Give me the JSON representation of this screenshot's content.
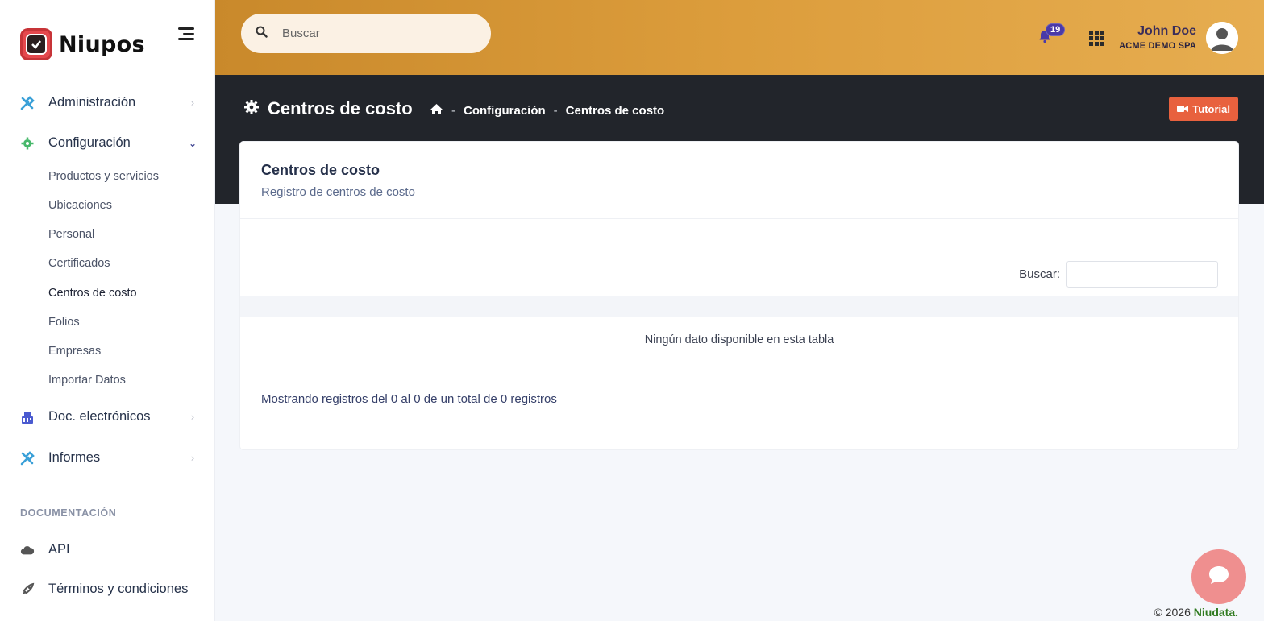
{
  "brand": {
    "name": "Niupos"
  },
  "header": {
    "search_placeholder": "Buscar",
    "notifications_count": "19",
    "user_name": "John Doe",
    "user_company": "ACME DEMO SPA"
  },
  "sidebar": {
    "items": [
      {
        "label": "Administración",
        "icon": "tools-icon",
        "chevron": "›"
      },
      {
        "label": "Configuración",
        "icon": "gear-icon",
        "chevron": "⌄"
      },
      {
        "label": "Doc. electrónicos",
        "icon": "register-icon",
        "chevron": "›"
      },
      {
        "label": "Informes",
        "icon": "tools-icon",
        "chevron": "›"
      }
    ],
    "subitems": [
      "Productos y servicios",
      "Ubicaciones",
      "Personal",
      "Certificados",
      "Centros de costo",
      "Folios",
      "Empresas",
      "Importar Datos"
    ],
    "active_subitem": "Centros de costo",
    "section_title": "DOCUMENTACIÓN",
    "docs": [
      {
        "label": "API",
        "icon": "cloud-icon"
      },
      {
        "label": "Términos y condiciones",
        "icon": "rocket-icon"
      }
    ]
  },
  "page": {
    "title": "Centros de costo",
    "breadcrumb": [
      "Configuración",
      "Centros de costo"
    ],
    "breadcrumb_sep": "-",
    "tutorial_label": "Tutorial"
  },
  "card": {
    "title": "Centros de costo",
    "subtitle": "Registro de centros de costo",
    "search_label": "Buscar:",
    "empty_message": "Ningún dato disponible en esta tabla",
    "info": "Mostrando registros del 0 al 0 de un total de 0 registros"
  },
  "footer": {
    "copyright": "© 2026",
    "brand": "Niudata."
  },
  "colors": {
    "accent": "#dc9d3c",
    "band": "#22252b",
    "tutorial": "#e8613e",
    "chat": "#ef8f8f"
  }
}
